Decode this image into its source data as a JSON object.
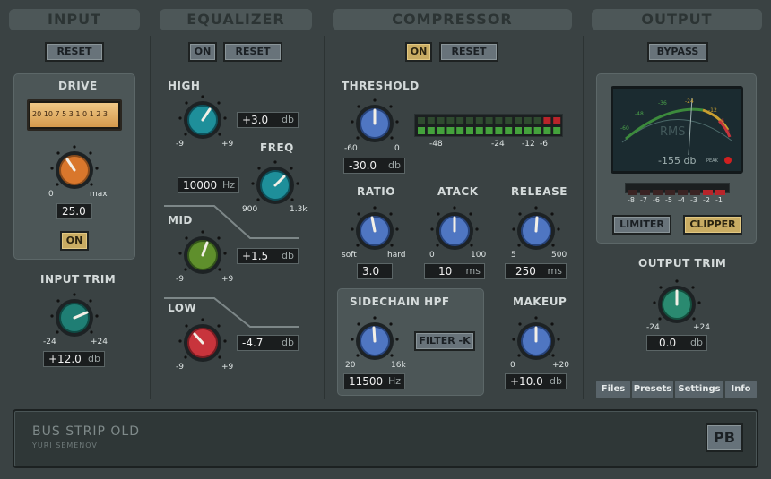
{
  "sections": {
    "input": "INPUT",
    "equalizer": "EQUALIZER",
    "compressor": "COMPRESSOR",
    "output": "OUTPUT"
  },
  "input": {
    "reset": "RESET",
    "drive_label": "DRIVE",
    "drive_meter_scale": "20 10 7 5 3 1 0 1 2 3",
    "drive_min": "0",
    "drive_max": "max",
    "drive_value": "25.0",
    "drive_on": "ON",
    "trim_label": "INPUT TRIM",
    "trim_min": "-24",
    "trim_max": "+24",
    "trim_value": "+12.0",
    "trim_unit": "db"
  },
  "equalizer": {
    "on": "ON",
    "reset": "RESET",
    "high_label": "HIGH",
    "high_min": "-9",
    "high_max": "+9",
    "high_value": "+3.0",
    "high_unit": "db",
    "freq_label": "FREQ",
    "freq_min": "900",
    "freq_max": "1.3k",
    "freq_value": "10000",
    "freq_unit": "Hz",
    "mid_label": "MID",
    "mid_min": "-9",
    "mid_max": "+9",
    "mid_value": "+1.5",
    "mid_unit": "db",
    "low_label": "LOW",
    "low_min": "-9",
    "low_max": "+9",
    "low_value": "-4.7",
    "low_unit": "db"
  },
  "compressor": {
    "on": "ON",
    "reset": "RESET",
    "threshold_label": "THRESHOLD",
    "threshold_min": "-60",
    "threshold_max": "0",
    "threshold_value": "-30.0",
    "threshold_unit": "db",
    "gr_scale": [
      "-48",
      "-24",
      "-12",
      "-6"
    ],
    "ratio_label": "RATIO",
    "ratio_min": "soft",
    "ratio_max": "hard",
    "ratio_value": "3.0",
    "attack_label": "ATACK",
    "attack_min": "0",
    "attack_max": "100",
    "attack_value": "10",
    "attack_unit": "ms",
    "release_label": "RELEASE",
    "release_min": "5",
    "release_max": "500",
    "release_value": "250",
    "release_unit": "ms",
    "sidechain_label": "SIDECHAIN  HPF",
    "sidechain_min": "20",
    "sidechain_max": "16k",
    "sidechain_value": "11500",
    "sidechain_unit": "Hz",
    "filter_k": "FILTER -K",
    "makeup_label": "MAKEUP",
    "makeup_min": "0",
    "makeup_max": "+20",
    "makeup_value": "+10.0",
    "makeup_unit": "db"
  },
  "output": {
    "bypass": "BYPASS",
    "vu_scale": [
      "-60",
      "-48",
      "-36",
      "-24",
      "-12",
      "-6",
      "0"
    ],
    "vu_label": "RMS",
    "vu_readout": "-155 db",
    "peak_label": "PEAK",
    "clip_scale": [
      "-8",
      "-7",
      "-6",
      "-5",
      "-4",
      "-3",
      "-2",
      "-1"
    ],
    "limiter": "LIMITER",
    "clipper": "CLIPPER",
    "trim_label": "OUTPUT TRIM",
    "trim_min": "-24",
    "trim_max": "+24",
    "trim_value": "0.0",
    "trim_unit": "db"
  },
  "tabs": [
    "Files",
    "Presets",
    "Settings",
    "Info"
  ],
  "footer": {
    "title": "BUS STRIP OLD",
    "author": "YURI SEMENOV",
    "pb": "PB"
  },
  "colors": {
    "teal": "#1e8f8a",
    "orange": "#d9772c",
    "green": "#5f8f2c",
    "red": "#c8343c",
    "blue": "#4f76c2",
    "green_out": "#2a8a70"
  }
}
